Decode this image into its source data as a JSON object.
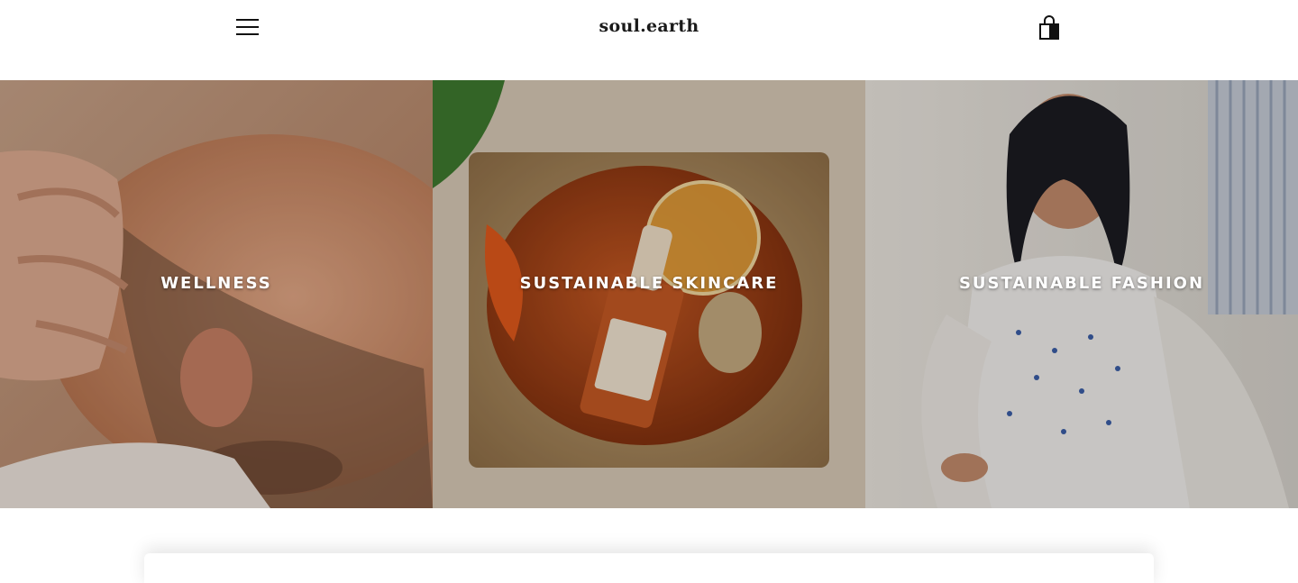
{
  "header": {
    "logo_text": "soul.earth",
    "menu_icon": "hamburger-menu-icon",
    "cart_icon": "shopping-bag-icon"
  },
  "tiles": [
    {
      "label": "WELLNESS",
      "image": "man-receiving-face-massage"
    },
    {
      "label": "SUSTAINABLE SKINCARE",
      "image": "facial-oil-bottle-on-wooden-tray"
    },
    {
      "label": "SUSTAINABLE FASHION",
      "image": "woman-in-white-cotton-dress"
    }
  ],
  "colors": {
    "text_dark": "#111111",
    "overlay_text": "#ffffff",
    "background": "#ffffff"
  }
}
